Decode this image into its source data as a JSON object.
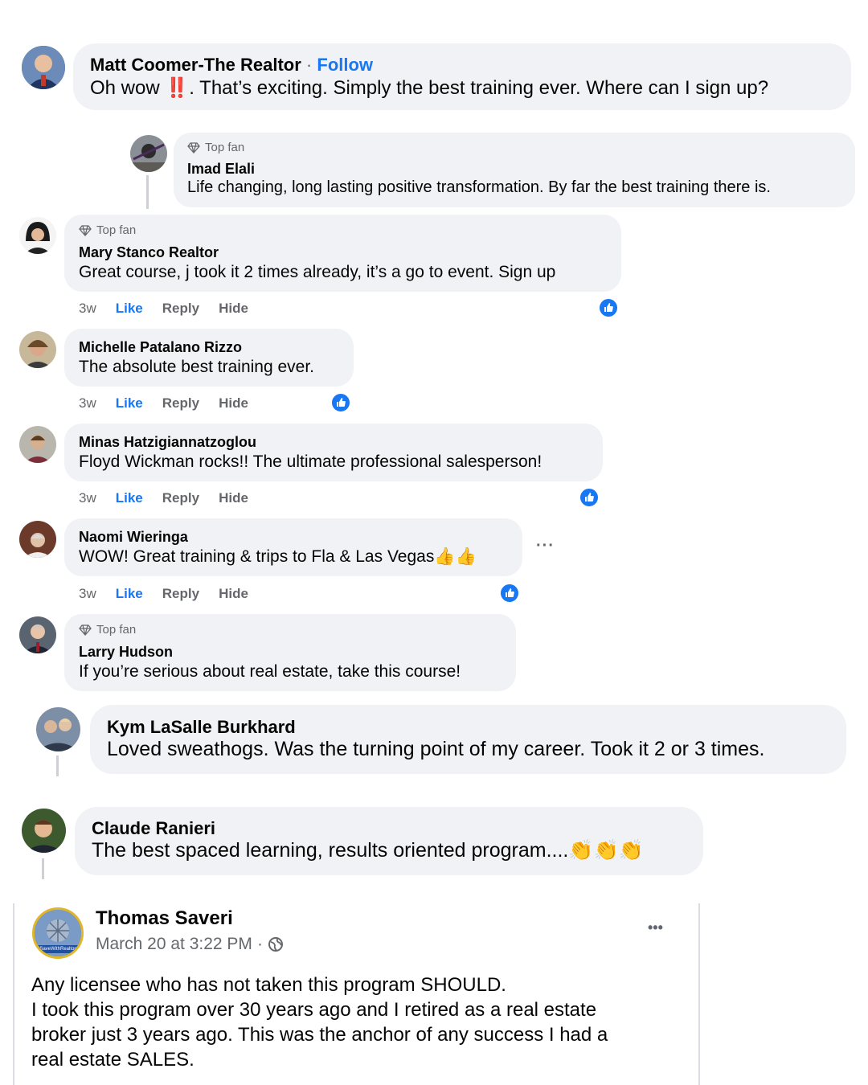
{
  "comments": [
    {
      "name": "Matt Coomer-The Realtor",
      "follow": "Follow",
      "follow_sep": "·",
      "text_before": "Oh wow ",
      "emoji": "‼️",
      "text_after": ". That’s exciting. Simply the best training ever. Where can I sign up?"
    },
    {
      "badge": "Top fan",
      "name": "Imad Elali",
      "text": "Life changing, long lasting positive transformation. By far the best training there is."
    },
    {
      "badge": "Top fan",
      "name": "Mary Stanco Realtor",
      "text": "Great course, j took it 2 times already, it’s a go to event. Sign up",
      "time": "3w",
      "like": "Like",
      "reply": "Reply",
      "hide": "Hide"
    },
    {
      "name": "Michelle Patalano Rizzo",
      "text": "The absolute best training ever.",
      "time": "3w",
      "like": "Like",
      "reply": "Reply",
      "hide": "Hide"
    },
    {
      "name": "Minas Hatzigiannatzoglou",
      "text": "Floyd Wickman rocks!! The ultimate professional salesperson!",
      "time": "3w",
      "like": "Like",
      "reply": "Reply",
      "hide": "Hide"
    },
    {
      "name": "Naomi Wieringa",
      "text": "WOW! Great training & trips to Fla & Las Vegas👍👍",
      "time": "3w",
      "like": "Like",
      "reply": "Reply",
      "hide": "Hide",
      "more": "···"
    },
    {
      "badge": "Top fan",
      "name": "Larry Hudson",
      "text": "If you’re serious about real estate, take this course!"
    },
    {
      "name": "Kym LaSalle Burkhard",
      "text": "Loved sweathogs. Was the turning point of my career. Took it 2 or 3 times."
    },
    {
      "name": "Claude Ranieri",
      "text": "The best spaced learning, results oriented program....👏👏👏"
    }
  ],
  "post": {
    "name": "Thomas Saveri",
    "date": "March 20 at 3:22 PM",
    "date_sep": "·",
    "more": "•••",
    "avatar_label": "#SaveWithRealtor",
    "lines": [
      "Any licensee who has not taken this program SHOULD.",
      "I took this program over 30 years ago and I retired as a real estate",
      "broker just 3 years ago. This was the anchor of any success I had a",
      "real estate SALES."
    ]
  },
  "colors": {
    "bubble": "#f0f2f5",
    "link": "#1877f2",
    "secondary": "#65676b",
    "alert": "#e41e3f"
  },
  "icons": [
    "diamond-icon",
    "thumbs-up-icon",
    "globe-icon",
    "more-icon"
  ]
}
